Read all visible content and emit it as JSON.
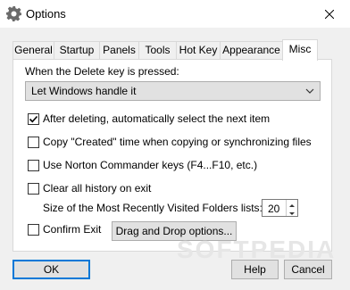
{
  "window": {
    "title": "Options",
    "icon": "gear-icon"
  },
  "tabs": [
    {
      "label": "General",
      "active": false
    },
    {
      "label": "Startup",
      "active": false
    },
    {
      "label": "Panels",
      "active": false
    },
    {
      "label": "Tools",
      "active": false
    },
    {
      "label": "Hot Key",
      "active": false
    },
    {
      "label": "Appearance",
      "active": false
    },
    {
      "label": "Misc",
      "active": true
    }
  ],
  "misc": {
    "delete_label": "When the Delete key is pressed:",
    "delete_select_value": "Let Windows handle it",
    "opt_select_next": {
      "label": "After deleting, automatically select the next item",
      "checked": true
    },
    "opt_copy_created": {
      "label": "Copy \"Created\" time when copying or synchronizing files",
      "checked": false
    },
    "opt_norton": {
      "label": "Use Norton Commander keys (F4...F10, etc.)",
      "checked": false
    },
    "opt_clear_history": {
      "label": "Clear all history on exit",
      "checked": false
    },
    "mru_label": "Size of the Most Recently Visited Folders lists:",
    "mru_value": "20",
    "opt_confirm_exit": {
      "label": "Confirm Exit",
      "checked": false
    },
    "dragdrop_button": "Drag and Drop options..."
  },
  "buttons": {
    "ok": "OK",
    "help": "Help",
    "cancel": "Cancel"
  },
  "watermark": "SOFTPEDIA"
}
